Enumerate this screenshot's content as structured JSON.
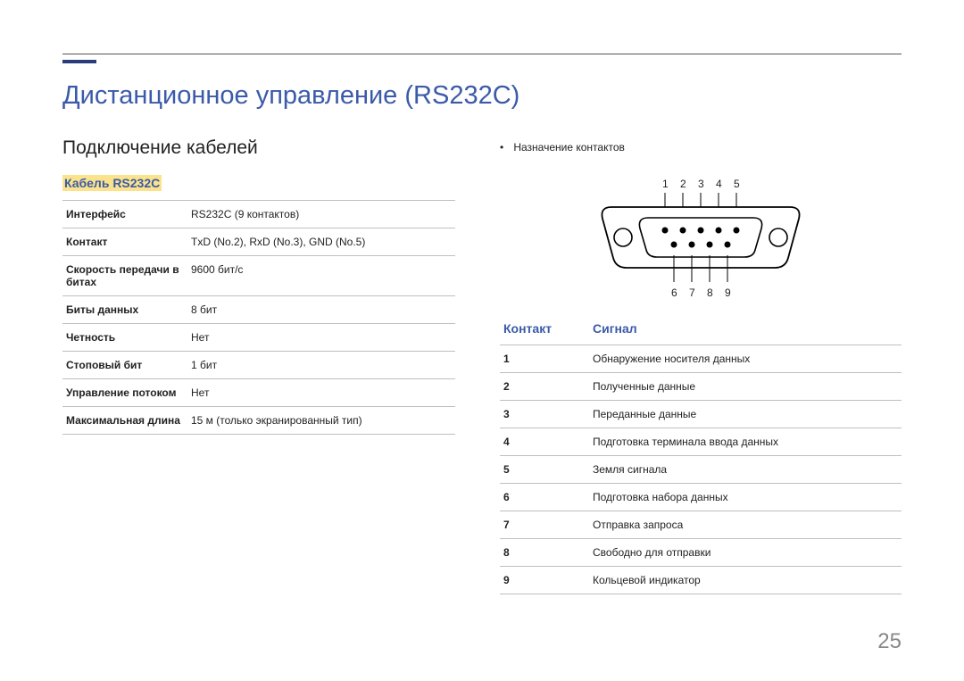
{
  "header": {
    "main_title": "Дистанционное управление (RS232C)",
    "section_title": "Подключение кабелей",
    "cable_title": "Кабель RS232C"
  },
  "spec_table": [
    {
      "k": "Интерфейс",
      "v": "RS232C (9 контактов)"
    },
    {
      "k": "Контакт",
      "v": "TxD (No.2), RxD (No.3), GND (No.5)"
    },
    {
      "k": "Скорость передачи в битах",
      "v": "9600 бит/с"
    },
    {
      "k": "Биты данных",
      "v": "8 бит"
    },
    {
      "k": "Четность",
      "v": "Нет"
    },
    {
      "k": "Стоповый бит",
      "v": "1 бит"
    },
    {
      "k": "Управление потоком",
      "v": "Нет"
    },
    {
      "k": "Максимальная длина",
      "v": "15 м (только экранированный тип)"
    }
  ],
  "pin_note": "Назначение контактов",
  "pin_labels_top": [
    "1",
    "2",
    "3",
    "4",
    "5"
  ],
  "pin_labels_bottom": [
    "6",
    "7",
    "8",
    "9"
  ],
  "pin_table": {
    "col1": "Контакт",
    "col2": "Сигнал",
    "rows": [
      {
        "n": "1",
        "s": "Обнаружение носителя данных"
      },
      {
        "n": "2",
        "s": "Полученные данные"
      },
      {
        "n": "3",
        "s": "Переданные данные"
      },
      {
        "n": "4",
        "s": "Подготовка терминала ввода данных"
      },
      {
        "n": "5",
        "s": "Земля сигнала"
      },
      {
        "n": "6",
        "s": "Подготовка набора данных"
      },
      {
        "n": "7",
        "s": "Отправка запроса"
      },
      {
        "n": "8",
        "s": "Свободно для отправки"
      },
      {
        "n": "9",
        "s": "Кольцевой индикатор"
      }
    ]
  },
  "page_number": "25"
}
